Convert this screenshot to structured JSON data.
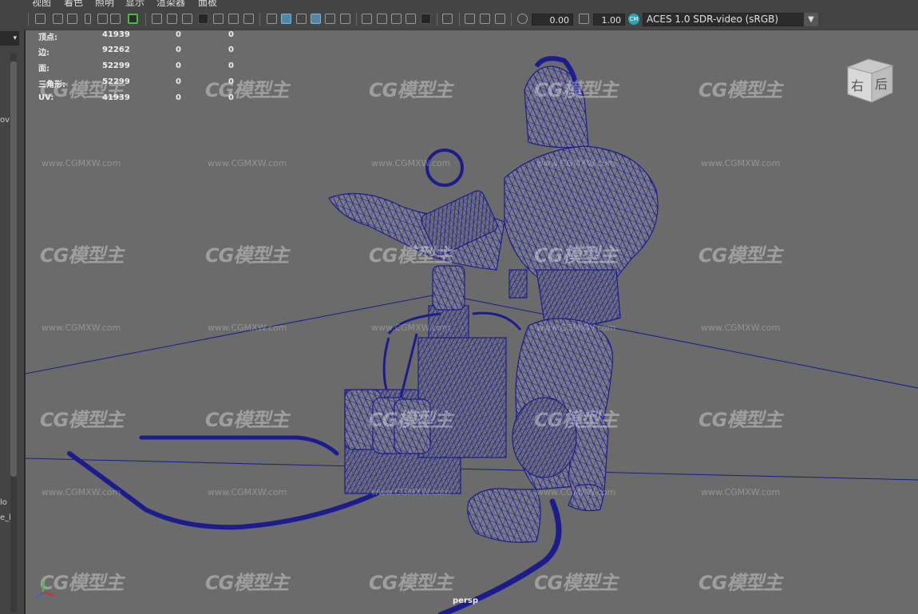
{
  "menu": {
    "items": [
      "视图",
      "着色",
      "照明",
      "显示",
      "渲染器",
      "面板"
    ]
  },
  "toolbar": {
    "exposure_value": "0.00",
    "gamma_value": "1.00",
    "color_management_badge": "CM",
    "view_transform": "ACES 1.0 SDR-video (sRGB)",
    "icons": [
      "camera-icon",
      "camera-attr-icon",
      "bookmark-icon",
      "image-plane-icon",
      "grid-icon",
      "film-gate-icon",
      "resolution-gate-icon",
      "gate-mask-icon",
      "field-chart-icon",
      "safe-action-icon",
      "safe-title-icon",
      "wireframe-icon",
      "smooth-shade-icon",
      "wireframe-on-shaded-icon",
      "textured-icon",
      "use-all-lights-icon",
      "shadows-icon",
      "screen-space-ao-icon",
      "motion-blur-icon",
      "anti-aliasing-icon",
      "depth-of-field-icon",
      "isolate-select-icon",
      "xray-icon",
      "xray-joints-icon",
      "backface-culling-icon",
      "exposure-icon",
      "gamma-icon",
      "color-management-icon"
    ]
  },
  "left_panel": {
    "dropdown_arrow": "▾",
    "fragments": [
      "ov",
      "lo",
      "e_l"
    ]
  },
  "hud": {
    "rows": [
      {
        "label": "顶点:",
        "value": "41939",
        "a": "0",
        "b": "0"
      },
      {
        "label": "边:",
        "value": "92262",
        "a": "0",
        "b": "0"
      },
      {
        "label": "面:",
        "value": "52299",
        "a": "0",
        "b": "0"
      },
      {
        "label": "三角形:",
        "value": "52299",
        "a": "0",
        "b": "0"
      },
      {
        "label": "UV:",
        "value": "41939",
        "a": "0",
        "b": "0"
      }
    ]
  },
  "viewcube": {
    "right_label": "右",
    "back_label": "后"
  },
  "camera_label": "persp",
  "watermark": {
    "logo_text": "CG模型主",
    "url_text": "www.CGMXW.com"
  },
  "colors": {
    "viewport_bg": "#6b6b6b",
    "ui_bg": "#444444",
    "wireframe": "#1c1c8c",
    "accent_blue": "#5285a6",
    "axis_green": "#43c043",
    "cm_badge": "#2aa6b3"
  }
}
